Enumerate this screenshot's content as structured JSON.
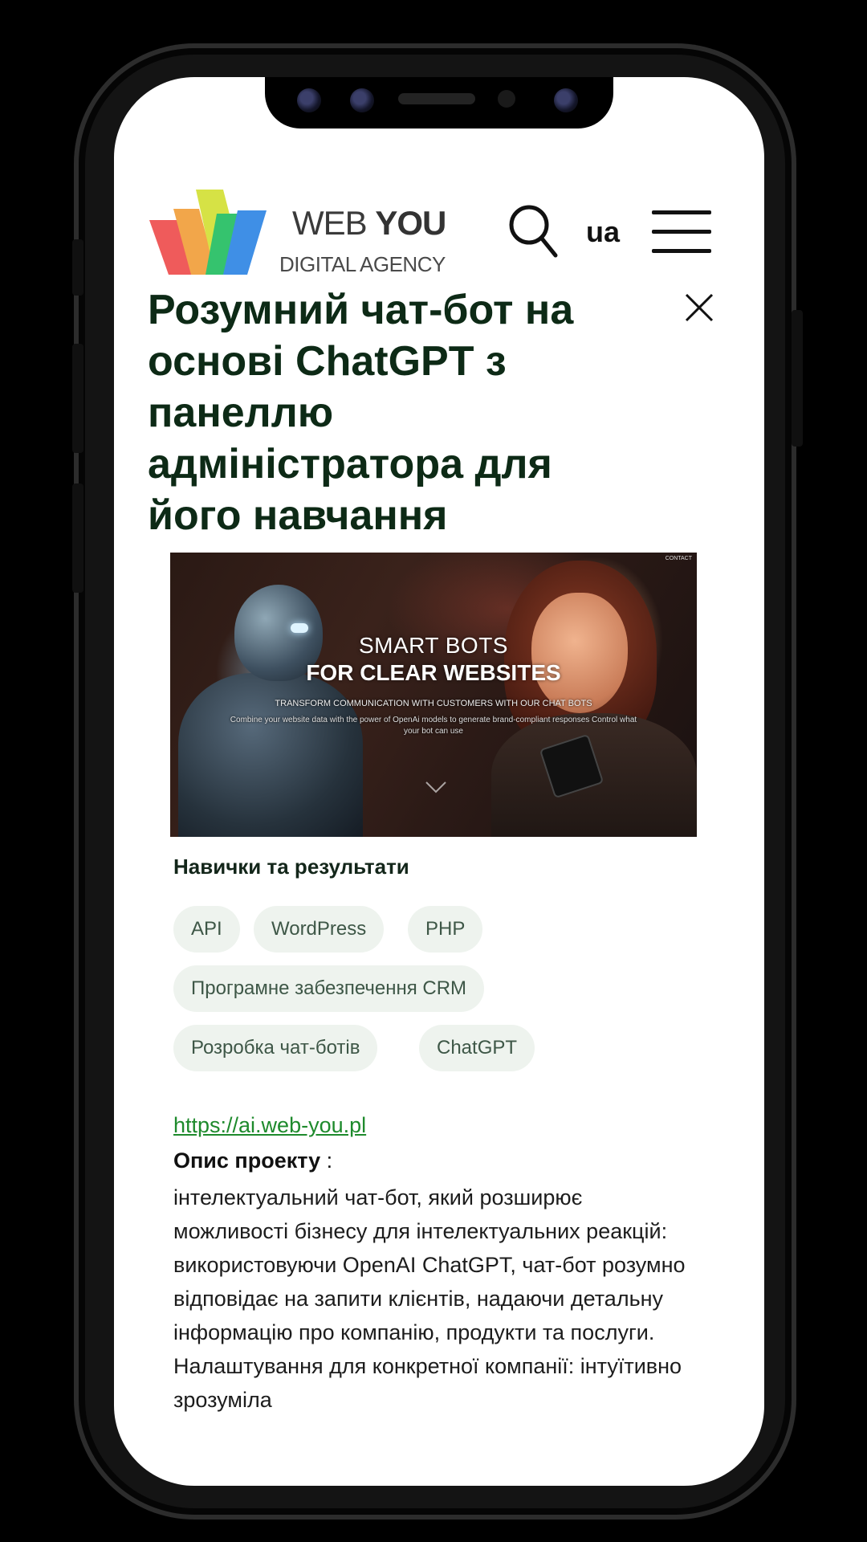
{
  "header": {
    "logo_word_light": "WEB",
    "logo_word_bold": "YOU",
    "logo_sub": "DIGITAL AGENCY",
    "lang": "ua",
    "search_icon": "search-icon",
    "menu_icon": "hamburger-menu-icon"
  },
  "page": {
    "title": "Розумний чат-бот на основі ChatGPT з панеллю адміністратора для його навчання",
    "close_icon": "close-icon"
  },
  "hero": {
    "contact": "CONTACT",
    "line1": "SMART BOTS",
    "line2": "FOR CLEAR WEBSITES",
    "line3": "TRANSFORM COMMUNICATION WITH CUSTOMERS WITH OUR CHAT BOTS",
    "line4": "Combine your website data with the power of OpenAi models to generate brand-compliant responses Control what your bot can use"
  },
  "skills": {
    "title": "Навички та результати",
    "tags": [
      "API",
      "WordPress",
      "PHP",
      "Програмне забезпечення CRM",
      "Розробка чат-ботів",
      "ChatGPT"
    ]
  },
  "project": {
    "link": "https://ai.web-you.pl",
    "desc_label": "Опис проекту",
    "desc_colon": " :",
    "desc_text": " інтелектуальний чат-бот, який розширює можливості бізнесу для інтелектуальних реакцій: використовуючи OpenAI ChatGPT, чат-бот розумно відповідає на запити клієнтів, надаючи детальну інформацію про компанію, продукти та послуги. Налаштування для конкретної компанії: інтуїтивно зрозуміла"
  },
  "colors": {
    "title": "#0d2a16",
    "link": "#1e8a2c",
    "tag_bg": "#eef3ee",
    "tag_text": "#3e5747"
  }
}
